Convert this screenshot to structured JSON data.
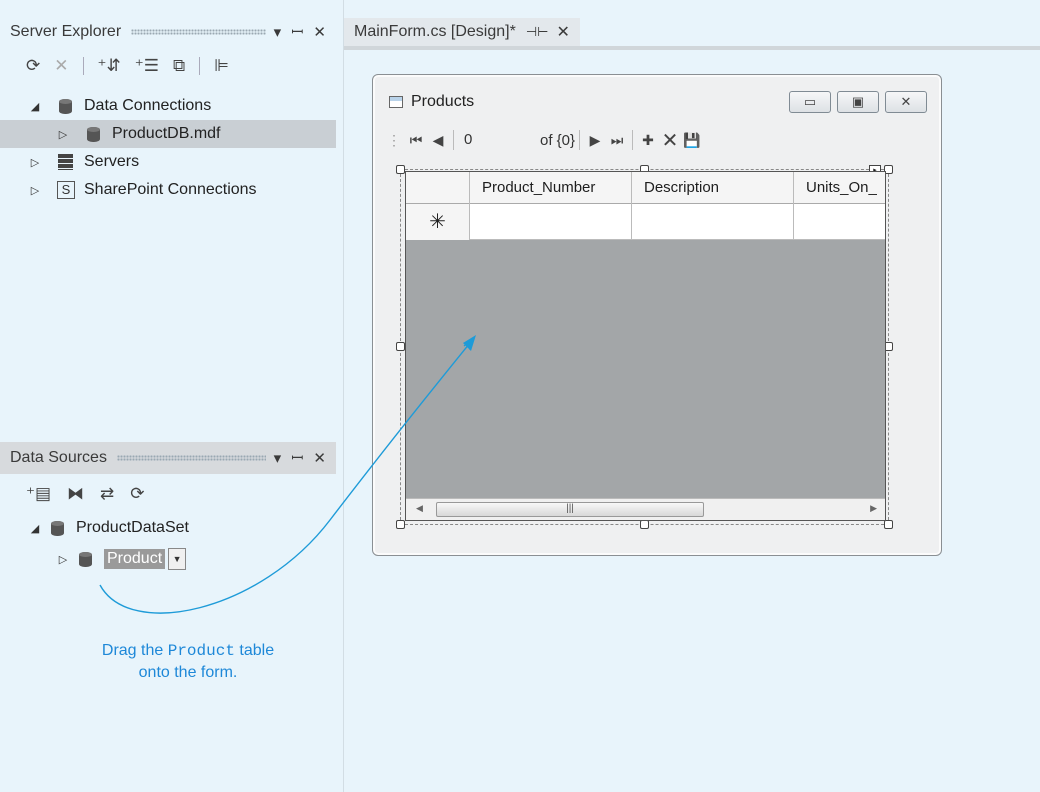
{
  "server_explorer": {
    "title": "Server Explorer",
    "pin": "↓ Ч",
    "close": "✕",
    "tree": [
      {
        "label": "Data Connections",
        "expanded": true
      },
      {
        "label": "ProductDB.mdf",
        "selected": true
      },
      {
        "label": "Servers"
      },
      {
        "label": "SharePoint Connections"
      }
    ]
  },
  "data_sources": {
    "title": "Data Sources",
    "pin": "▾ Ч",
    "close": "✕",
    "dataset": "ProductDataSet",
    "table": "Product"
  },
  "document": {
    "tab_label": "MainForm.cs [Design]*",
    "tab_close": "✕"
  },
  "form": {
    "title": "Products",
    "nav": {
      "position": "0",
      "count": "of {0}"
    },
    "grid_columns": [
      "Product_Number",
      "Description",
      "Units_On_"
    ],
    "new_row_marker": "✳"
  },
  "callout": {
    "prefix": "Drag the",
    "code": "Product",
    "suffix": "table",
    "line2": "onto the form."
  },
  "colors": {
    "background": "#e8f4fb",
    "arrow": "#1e9bd8",
    "callout_text": "#1e88d8",
    "grid_area": "#a3a6a8"
  }
}
